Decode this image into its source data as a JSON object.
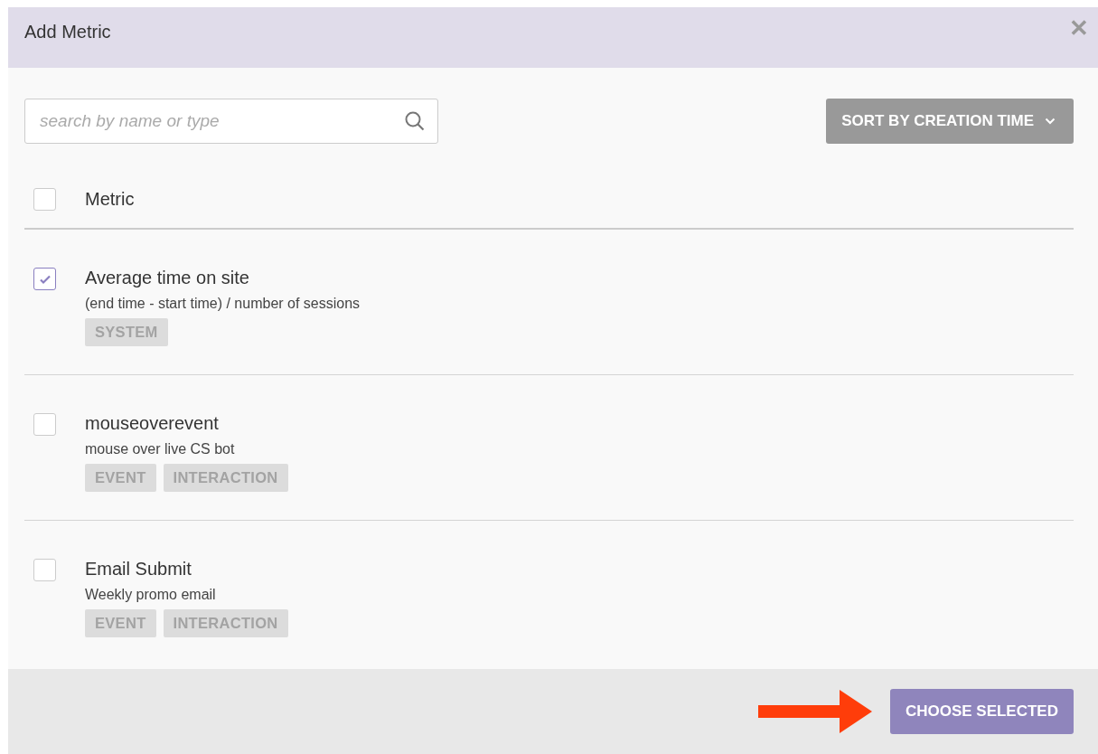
{
  "dialog": {
    "title": "Add Metric",
    "close": "✕"
  },
  "search": {
    "placeholder": "search by name or type"
  },
  "sort_button": {
    "label": "SORT BY CREATION TIME"
  },
  "header": {
    "label": "Metric",
    "checked": false
  },
  "metrics": [
    {
      "name": "Average time on site",
      "description": "(end time - start time) / number of sessions",
      "tags": [
        "SYSTEM"
      ],
      "checked": true
    },
    {
      "name": "mouseoverevent",
      "description": "mouse over live CS bot",
      "tags": [
        "EVENT",
        "INTERACTION"
      ],
      "checked": false
    },
    {
      "name": "Email Submit",
      "description": "Weekly promo email",
      "tags": [
        "EVENT",
        "INTERACTION"
      ],
      "checked": false
    }
  ],
  "footer": {
    "button": "CHOOSE SELECTED"
  }
}
